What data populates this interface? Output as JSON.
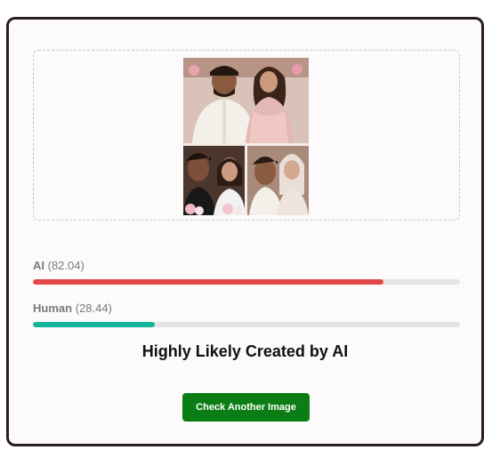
{
  "preview": {
    "image_alt": "Uploaded image preview: couple in traditional wedding attire, collage of three frames"
  },
  "scores": [
    {
      "label": "AI",
      "score_text": "(82.04)",
      "value": 82.04,
      "color": "#e44848"
    },
    {
      "label": "Human",
      "score_text": "(28.44)",
      "value": 28.44,
      "color": "#12b59c"
    }
  ],
  "result": {
    "verdict": "Highly Likely Created by AI"
  },
  "actions": {
    "check_another_label": "Check Another Image",
    "button_color": "#0c7d14"
  }
}
